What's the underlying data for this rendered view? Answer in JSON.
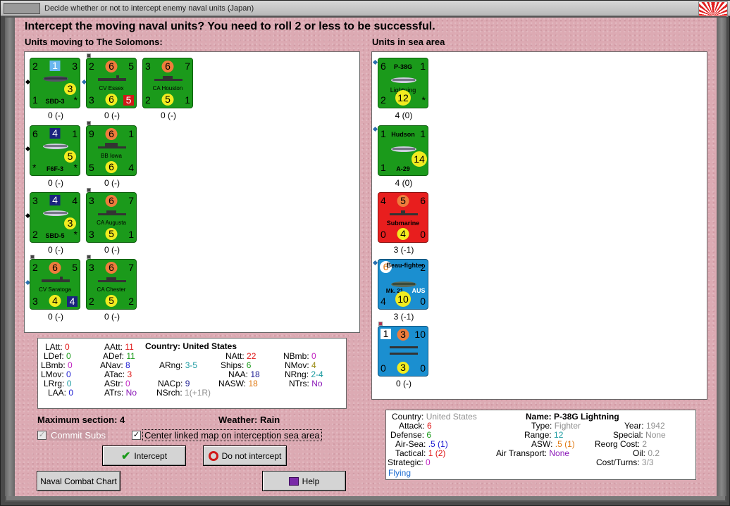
{
  "window": {
    "title": "Decide whether or not to intercept enemy naval units (Japan)"
  },
  "header": "Intercept the moving naval units?  You need to roll 2 or less to be successful.",
  "left_section_label": "Units moving to The Solomons:",
  "right_section_label": "Units in sea area",
  "moving_units": [
    {
      "name": "SBD-3",
      "tl": "2",
      "tc": "1",
      "tr": "3",
      "mid": "3",
      "bl": "1",
      "br": "*",
      "caption": "0 (-)"
    },
    {
      "name": "CV Essex",
      "tl": "2",
      "tc": "6",
      "tr": "5",
      "bl": "3",
      "bc": "6",
      "br": "5",
      "caption": "0 (-)"
    },
    {
      "name": "CA Houston",
      "tl": "3",
      "tc": "6",
      "tr": "7",
      "bl": "2",
      "bc": "5",
      "br": "1",
      "caption": "0 (-)"
    },
    {
      "name": "F6F-3",
      "tl": "6",
      "tc": "4",
      "tr": "1",
      "mid": "5",
      "bl": "*",
      "br": "*",
      "caption": "0 (-)"
    },
    {
      "name": "BB Iowa",
      "tl": "9",
      "tc": "6",
      "tr": "1",
      "bl": "5",
      "bc": "6",
      "br": "4",
      "caption": "0 (-)"
    },
    {
      "name": "SBD-5",
      "tl": "3",
      "tc": "4",
      "tr": "4",
      "mid": "3",
      "bl": "2",
      "br": "*",
      "caption": "0 (-)"
    },
    {
      "name": "CA Augusta",
      "tl": "3",
      "tc": "6",
      "tr": "7",
      "bl": "3",
      "bc": "5",
      "br": "1",
      "caption": "0 (-)"
    },
    {
      "name": "CV Saratoga",
      "tl": "2",
      "tc": "6",
      "tr": "5",
      "bl": "3",
      "bc": "4",
      "br": "4",
      "caption": "0 (-)"
    },
    {
      "name": "CA Chester",
      "tl": "3",
      "tc": "6",
      "tr": "7",
      "bl": "2",
      "bc": "5",
      "br": "2",
      "caption": "0 (-)"
    }
  ],
  "sea_units": [
    {
      "name": "P-38G",
      "subname": "Lightning",
      "tl": "6",
      "tr": "1",
      "bl": "2",
      "bc": "12",
      "br": "*",
      "caption": "4 (0)"
    },
    {
      "name": "Hudson",
      "subname": "A-29",
      "tl": "1",
      "tr": "1",
      "bl": "1",
      "br": "14",
      "caption": "4 (0)"
    },
    {
      "name": "Submarine",
      "tl": "4",
      "tc": "5",
      "tr": "6",
      "bl": "0",
      "bc": "4",
      "br": "0",
      "caption": "3 (-1)"
    },
    {
      "name": "Beau-fighter",
      "subname": "Mk. 21",
      "nation": "AUS",
      "tl": "6",
      "tr": "2",
      "bl": "4",
      "bc": "10",
      "br": "0",
      "caption": "3 (-1)"
    },
    {
      "name": "",
      "tl": "1",
      "tc": "3",
      "tr": "10",
      "bl": "0",
      "bc": "3",
      "br": "0",
      "caption": "0 (-)"
    }
  ],
  "country_stats": {
    "country_label": "Country:",
    "country_value": "United States",
    "rows": [
      {
        "k": "LAtt:",
        "v": "0"
      },
      {
        "k": "LDef:",
        "v": "0"
      },
      {
        "k": "LBmb:",
        "v": "0"
      },
      {
        "k": "LMov:",
        "v": "0"
      },
      {
        "k": "LRrg:",
        "v": "0"
      },
      {
        "k": "LAA:",
        "v": "0"
      },
      {
        "k": "AAtt:",
        "v": "11"
      },
      {
        "k": "ADef:",
        "v": "11"
      },
      {
        "k": "ANav:",
        "v": "8"
      },
      {
        "k": "ATac:",
        "v": "3"
      },
      {
        "k": "AStr:",
        "v": "0"
      },
      {
        "k": "ATrs:",
        "v": "No"
      },
      {
        "k": "ARng:",
        "v": "3-5"
      },
      {
        "k": "NACp:",
        "v": "9"
      },
      {
        "k": "NSrch:",
        "v": "1(+1R)"
      },
      {
        "k": "NAtt:",
        "v": "22"
      },
      {
        "k": "Ships:",
        "v": "6"
      },
      {
        "k": "NAA:",
        "v": "18"
      },
      {
        "k": "NASW:",
        "v": "18"
      },
      {
        "k": "NBmb:",
        "v": "0"
      },
      {
        "k": "NMov:",
        "v": "4"
      },
      {
        "k": "NRng:",
        "v": "2-4"
      },
      {
        "k": "NTrs:",
        "v": "No"
      }
    ]
  },
  "max_section": "Maximum section: 4",
  "weather": "Weather:  Rain",
  "commit_subs": "Commit Subs",
  "center_map": "Center linked map on interception sea area",
  "buttons": {
    "intercept": "Intercept",
    "do_not_intercept": "Do not intercept",
    "naval_combat_chart": "Naval Combat Chart",
    "help": "Help"
  },
  "unit_info": {
    "country_label": "Country:",
    "country": "United States",
    "attack_label": "Attack:",
    "attack": "6",
    "defense_label": "Defense:",
    "defense": "6",
    "airsea_label": "Air-Sea:",
    "airsea": ".5 (1)",
    "tactical_label": "Tactical:",
    "tactical": "1 (2)",
    "strategic_label": "Strategic:",
    "strategic": "0",
    "flying": "Flying",
    "name_label": "Name:",
    "name": "P-38G Lightning",
    "type_label": "Type:",
    "type": "Fighter",
    "range_label": "Range:",
    "range": "12",
    "asw_label": "ASW:",
    "asw": ".5 (1)",
    "air_transport_label": "Air Transport:",
    "air_transport": "None",
    "year_label": "Year:",
    "year": "1942",
    "special_label": "Special:",
    "special": "None",
    "reorg_label": "Reorg Cost:",
    "reorg": "2",
    "oil_label": "Oil:",
    "oil": "0.2",
    "cost_label": "Cost/Turns:",
    "cost": "3/3"
  }
}
